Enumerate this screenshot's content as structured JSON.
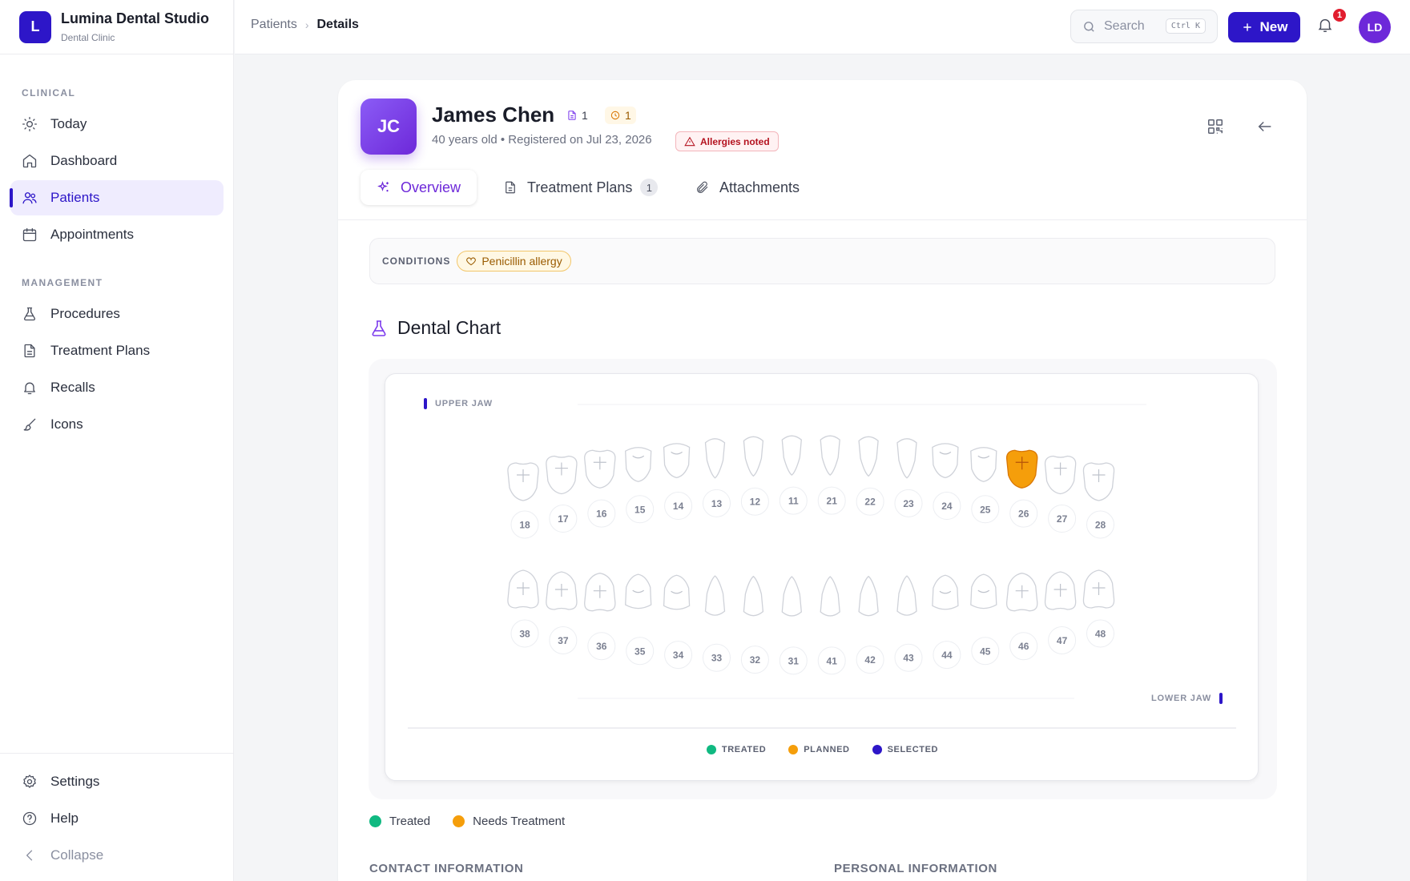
{
  "brand": {
    "logo_letter": "L",
    "name": "Lumina Dental Studio",
    "subtitle": "Dental Clinic"
  },
  "sidebar": {
    "sections": [
      "CLINICAL",
      "MANAGEMENT"
    ],
    "items": [
      {
        "label": "Today",
        "icon": "sun-icon"
      },
      {
        "label": "Dashboard",
        "icon": "home-icon"
      },
      {
        "label": "Patients",
        "icon": "users-icon",
        "active": true
      },
      {
        "label": "Appointments",
        "icon": "calendar-icon"
      },
      {
        "label": "Procedures",
        "icon": "flask-icon"
      },
      {
        "label": "Treatment Plans",
        "icon": "document-icon"
      },
      {
        "label": "Recalls",
        "icon": "bell-icon"
      },
      {
        "label": "Icons",
        "icon": "brush-icon"
      }
    ],
    "bottom": [
      {
        "label": "Settings",
        "icon": "gear-icon"
      },
      {
        "label": "Help",
        "icon": "help-icon"
      },
      {
        "label": "Collapse",
        "icon": "chevron-left-icon"
      }
    ]
  },
  "topbar": {
    "breadcrumb": [
      "Patients",
      "Details"
    ],
    "search_placeholder": "Search",
    "search_shortcut": "Ctrl K",
    "new_label": "New",
    "notification_count": "1",
    "user_initials": "LD"
  },
  "patient": {
    "initials": "JC",
    "name": "James Chen",
    "documents_count": "1",
    "pending_count": "1",
    "meta": "40 years old • Registered on Jul 23, 2026",
    "allergy_badge": "Allergies noted"
  },
  "tabs": [
    {
      "label": "Overview",
      "active": true
    },
    {
      "label": "Treatment Plans",
      "count": "1"
    },
    {
      "label": "Attachments"
    }
  ],
  "conditions": {
    "label": "CONDITIONS",
    "items": [
      "Penicillin allergy"
    ]
  },
  "dental_chart": {
    "title": "Dental Chart",
    "upper_label": "UPPER JAW",
    "lower_label": "LOWER JAW",
    "upper_teeth": [
      "18",
      "17",
      "16",
      "15",
      "14",
      "13",
      "12",
      "11",
      "21",
      "22",
      "23",
      "24",
      "25",
      "26",
      "27",
      "28"
    ],
    "lower_teeth": [
      "38",
      "37",
      "36",
      "35",
      "34",
      "33",
      "32",
      "31",
      "41",
      "42",
      "43",
      "44",
      "45",
      "46",
      "47",
      "48"
    ],
    "planned_teeth": [
      "26"
    ],
    "legend": [
      {
        "label": "TREATED",
        "color": "#10b981"
      },
      {
        "label": "PLANNED",
        "color": "#f59e0b"
      },
      {
        "label": "SELECTED",
        "color": "#2d16c8"
      }
    ]
  },
  "key": [
    {
      "label": "Treated",
      "color": "#10b981"
    },
    {
      "label": "Needs Treatment",
      "color": "#f59e0b"
    }
  ],
  "sections_below": [
    "CONTACT INFORMATION",
    "PERSONAL INFORMATION"
  ]
}
